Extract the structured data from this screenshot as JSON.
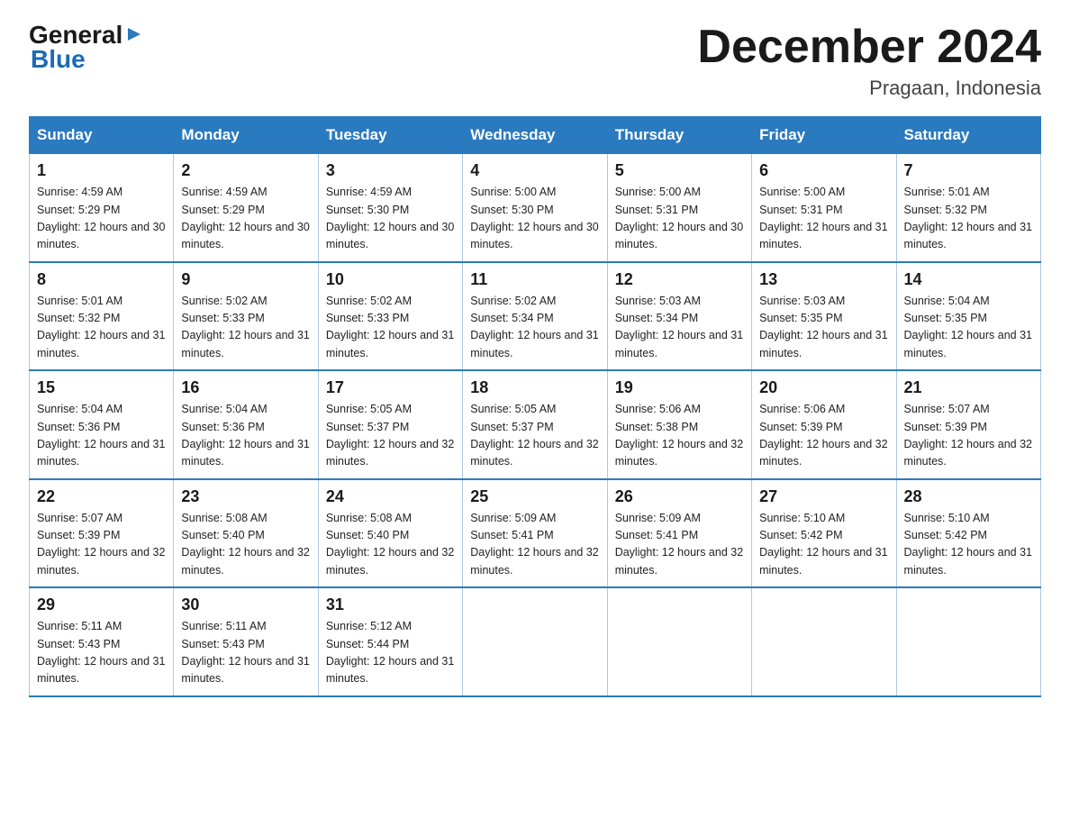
{
  "logo": {
    "general": "General",
    "arrow": "▶",
    "blue": "Blue"
  },
  "header": {
    "month_year": "December 2024",
    "location": "Pragaan, Indonesia"
  },
  "days_of_week": [
    "Sunday",
    "Monday",
    "Tuesday",
    "Wednesday",
    "Thursday",
    "Friday",
    "Saturday"
  ],
  "weeks": [
    [
      {
        "day": "1",
        "sunrise": "4:59 AM",
        "sunset": "5:29 PM",
        "daylight": "12 hours and 30 minutes."
      },
      {
        "day": "2",
        "sunrise": "4:59 AM",
        "sunset": "5:29 PM",
        "daylight": "12 hours and 30 minutes."
      },
      {
        "day": "3",
        "sunrise": "4:59 AM",
        "sunset": "5:30 PM",
        "daylight": "12 hours and 30 minutes."
      },
      {
        "day": "4",
        "sunrise": "5:00 AM",
        "sunset": "5:30 PM",
        "daylight": "12 hours and 30 minutes."
      },
      {
        "day": "5",
        "sunrise": "5:00 AM",
        "sunset": "5:31 PM",
        "daylight": "12 hours and 30 minutes."
      },
      {
        "day": "6",
        "sunrise": "5:00 AM",
        "sunset": "5:31 PM",
        "daylight": "12 hours and 31 minutes."
      },
      {
        "day": "7",
        "sunrise": "5:01 AM",
        "sunset": "5:32 PM",
        "daylight": "12 hours and 31 minutes."
      }
    ],
    [
      {
        "day": "8",
        "sunrise": "5:01 AM",
        "sunset": "5:32 PM",
        "daylight": "12 hours and 31 minutes."
      },
      {
        "day": "9",
        "sunrise": "5:02 AM",
        "sunset": "5:33 PM",
        "daylight": "12 hours and 31 minutes."
      },
      {
        "day": "10",
        "sunrise": "5:02 AM",
        "sunset": "5:33 PM",
        "daylight": "12 hours and 31 minutes."
      },
      {
        "day": "11",
        "sunrise": "5:02 AM",
        "sunset": "5:34 PM",
        "daylight": "12 hours and 31 minutes."
      },
      {
        "day": "12",
        "sunrise": "5:03 AM",
        "sunset": "5:34 PM",
        "daylight": "12 hours and 31 minutes."
      },
      {
        "day": "13",
        "sunrise": "5:03 AM",
        "sunset": "5:35 PM",
        "daylight": "12 hours and 31 minutes."
      },
      {
        "day": "14",
        "sunrise": "5:04 AM",
        "sunset": "5:35 PM",
        "daylight": "12 hours and 31 minutes."
      }
    ],
    [
      {
        "day": "15",
        "sunrise": "5:04 AM",
        "sunset": "5:36 PM",
        "daylight": "12 hours and 31 minutes."
      },
      {
        "day": "16",
        "sunrise": "5:04 AM",
        "sunset": "5:36 PM",
        "daylight": "12 hours and 31 minutes."
      },
      {
        "day": "17",
        "sunrise": "5:05 AM",
        "sunset": "5:37 PM",
        "daylight": "12 hours and 32 minutes."
      },
      {
        "day": "18",
        "sunrise": "5:05 AM",
        "sunset": "5:37 PM",
        "daylight": "12 hours and 32 minutes."
      },
      {
        "day": "19",
        "sunrise": "5:06 AM",
        "sunset": "5:38 PM",
        "daylight": "12 hours and 32 minutes."
      },
      {
        "day": "20",
        "sunrise": "5:06 AM",
        "sunset": "5:39 PM",
        "daylight": "12 hours and 32 minutes."
      },
      {
        "day": "21",
        "sunrise": "5:07 AM",
        "sunset": "5:39 PM",
        "daylight": "12 hours and 32 minutes."
      }
    ],
    [
      {
        "day": "22",
        "sunrise": "5:07 AM",
        "sunset": "5:39 PM",
        "daylight": "12 hours and 32 minutes."
      },
      {
        "day": "23",
        "sunrise": "5:08 AM",
        "sunset": "5:40 PM",
        "daylight": "12 hours and 32 minutes."
      },
      {
        "day": "24",
        "sunrise": "5:08 AM",
        "sunset": "5:40 PM",
        "daylight": "12 hours and 32 minutes."
      },
      {
        "day": "25",
        "sunrise": "5:09 AM",
        "sunset": "5:41 PM",
        "daylight": "12 hours and 32 minutes."
      },
      {
        "day": "26",
        "sunrise": "5:09 AM",
        "sunset": "5:41 PM",
        "daylight": "12 hours and 32 minutes."
      },
      {
        "day": "27",
        "sunrise": "5:10 AM",
        "sunset": "5:42 PM",
        "daylight": "12 hours and 31 minutes."
      },
      {
        "day": "28",
        "sunrise": "5:10 AM",
        "sunset": "5:42 PM",
        "daylight": "12 hours and 31 minutes."
      }
    ],
    [
      {
        "day": "29",
        "sunrise": "5:11 AM",
        "sunset": "5:43 PM",
        "daylight": "12 hours and 31 minutes."
      },
      {
        "day": "30",
        "sunrise": "5:11 AM",
        "sunset": "5:43 PM",
        "daylight": "12 hours and 31 minutes."
      },
      {
        "day": "31",
        "sunrise": "5:12 AM",
        "sunset": "5:44 PM",
        "daylight": "12 hours and 31 minutes."
      },
      null,
      null,
      null,
      null
    ]
  ]
}
